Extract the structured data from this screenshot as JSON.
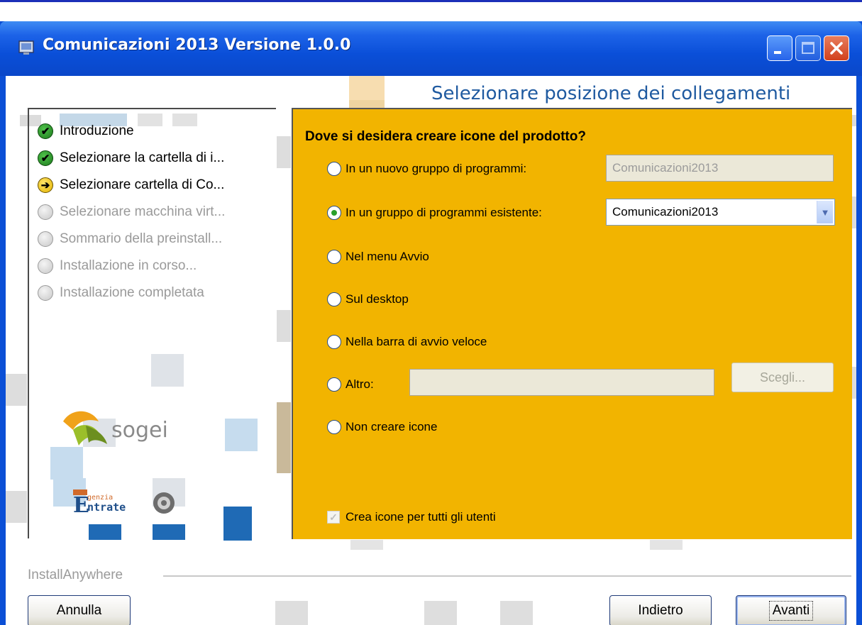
{
  "window": {
    "title": "Comunicazioni 2013 Versione 1.0.0"
  },
  "header": {
    "title": "Selezionare posizione dei collegamenti"
  },
  "steps": [
    {
      "label": "Introduzione",
      "state": "done"
    },
    {
      "label": "Selezionare la cartella di i...",
      "state": "done"
    },
    {
      "label": "Selezionare cartella di Co...",
      "state": "current"
    },
    {
      "label": "Selezionare macchina virt...",
      "state": "pending"
    },
    {
      "label": "Sommario della preinstall...",
      "state": "pending"
    },
    {
      "label": "Installazione in corso...",
      "state": "pending"
    },
    {
      "label": "Installazione completata",
      "state": "pending"
    }
  ],
  "logos": {
    "sogei": "sogei",
    "entrate_small": "genzia",
    "entrate": "ntrate"
  },
  "main": {
    "question": "Dove si desidera creare icone del prodotto?",
    "options": [
      {
        "label": "In un nuovo gruppo di programmi:",
        "checked": false
      },
      {
        "label": "In un gruppo di programmi esistente:",
        "checked": true
      },
      {
        "label": "Nel menu Avvio",
        "checked": false
      },
      {
        "label": "Sul desktop",
        "checked": false
      },
      {
        "label": "Nella barra di avvio veloce",
        "checked": false
      },
      {
        "label": "Altro:",
        "checked": false
      },
      {
        "label": "Non creare icone",
        "checked": false
      }
    ],
    "new_group_value": "Comunicazioni2013",
    "existing_group_selected": "Comunicazioni2013",
    "other_path_value": "",
    "choose_button": "Scegli...",
    "all_users_checkbox": {
      "label": "Crea icone per tutti gli utenti",
      "checked": true
    }
  },
  "footer": {
    "brand": "InstallAnywhere",
    "cancel_button": "Annulla",
    "back_button": "Indietro",
    "next_button": "Avanti"
  },
  "colors": {
    "panel_accent": "#f2b400",
    "title_bar": "#0a4fd8",
    "header_text": "#1f5aa0"
  }
}
